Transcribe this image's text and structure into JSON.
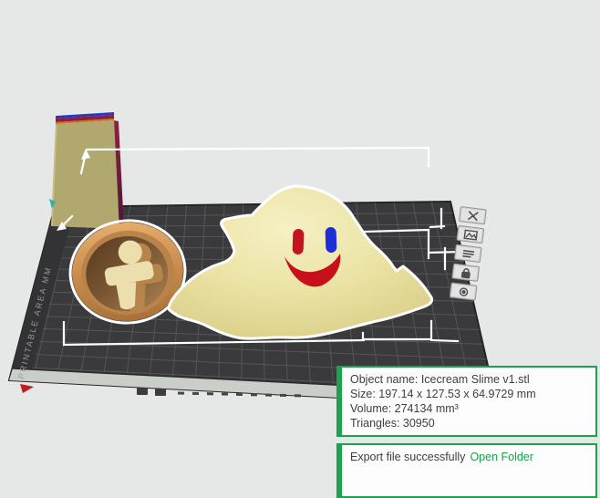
{
  "scene": {
    "background_color": "#e6e7e7"
  },
  "plate": {
    "surface_color": "#3a3a3c",
    "grid_line_color": "#58585b",
    "edge_band_color": "#c9cec9",
    "side_label": "PRINTABLE AREA MM",
    "corner_icons": [
      "delete-plate",
      "arrange-plate",
      "rename-plate",
      "lock-plate",
      "plate-settings"
    ]
  },
  "models": {
    "slime": {
      "body_color": "#ece4a6",
      "left_eye_color": "#c3141f",
      "right_eye_color": "#1e2ed6",
      "mouth_color": "#c8101c",
      "selected": true
    },
    "cup": {
      "body_color": "#c98e4f"
    },
    "box": {
      "body_color": "#b1a870"
    }
  },
  "info_panel": {
    "border_color": "#1aa24f",
    "object_name": "Object name: Icecream Slime v1.stl",
    "size": "Size: 197.14 x 127.53 x 64.9729 mm",
    "volume": "Volume: 274134 mm³",
    "triangles": "Triangles: 30950"
  },
  "notification": {
    "message": "Export file successfully",
    "action_label": "Open Folder"
  }
}
